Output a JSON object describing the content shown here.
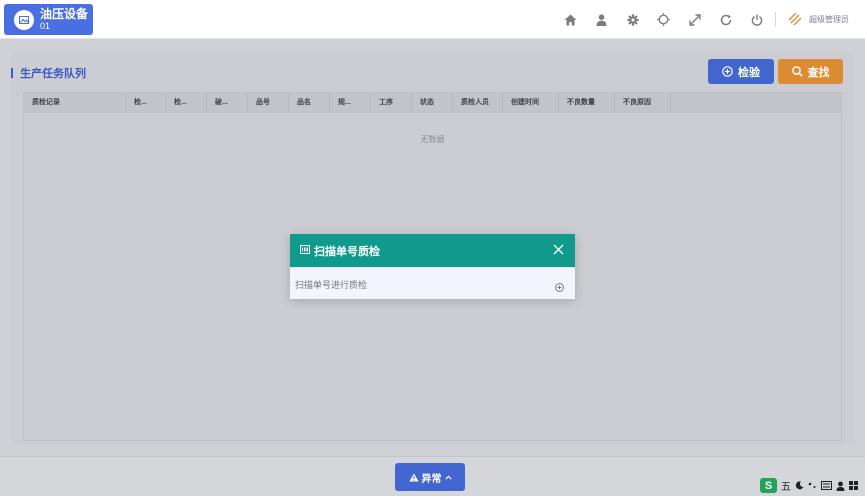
{
  "device": {
    "title": "油压设备",
    "code": "01",
    "icon": "image-icon"
  },
  "topbar": {
    "icons": [
      "home-icon",
      "user-icon",
      "gear-icon",
      "brightness-icon",
      "expand-icon",
      "refresh-icon",
      "power-icon"
    ],
    "user_name": "超级管理员"
  },
  "panel": {
    "title": "生产任务队列",
    "check_button": "检验",
    "find_button": "查找"
  },
  "table": {
    "columns": [
      "质检记录",
      "检...",
      "检...",
      "破...",
      "品号",
      "品名",
      "规...",
      "工序",
      "状态",
      "质检人员",
      "创建时间",
      "不良数量",
      "不良原因"
    ],
    "empty_text": "无数据"
  },
  "modal": {
    "title": "扫描单号质检",
    "placeholder": "扫描单号进行质检"
  },
  "footer": {
    "abnormal_button": "异常"
  },
  "ime": {
    "label": "五"
  },
  "colors": {
    "primary": "#4266cf",
    "orange": "#dc8b32",
    "teal": "#0f9a8c"
  }
}
